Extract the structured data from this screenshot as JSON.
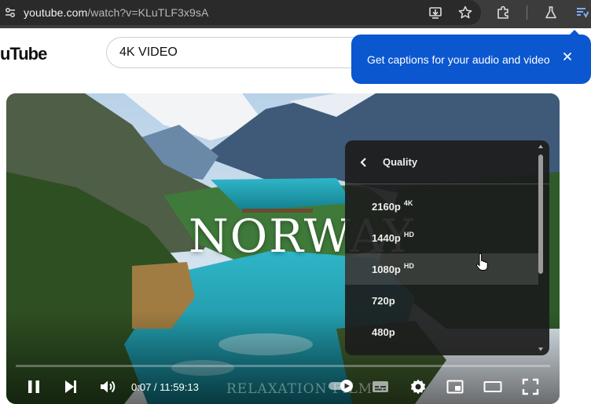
{
  "browser": {
    "url_host": "youtube.com",
    "url_path": "/watch?v=KLuTLF3x9sA",
    "icons": [
      "site-settings-icon",
      "install-app-icon",
      "bookmark-star-icon",
      "extensions-icon",
      "labs-flask-icon",
      "reading-list-icon"
    ]
  },
  "youtube": {
    "logo_text": "uTube",
    "search_value": "4K VIDEO"
  },
  "promo": {
    "text": "Get captions for your audio and video",
    "bg_color": "#0b57d0"
  },
  "video": {
    "title_overlay": "NORWAY",
    "watermark": "RELAXATION FILM",
    "time_current": "0:07",
    "time_separator": " / ",
    "time_total": "11:59:13",
    "progress": 0.0
  },
  "quality_menu": {
    "title": "Quality",
    "items": [
      {
        "label": "2160p",
        "badge": "4K"
      },
      {
        "label": "1440p",
        "badge": "HD"
      },
      {
        "label": "1080p",
        "badge": "HD"
      },
      {
        "label": "720p",
        "badge": ""
      },
      {
        "label": "480p",
        "badge": ""
      }
    ],
    "highlighted_index": 2
  },
  "controls": {
    "icons": [
      "pause-icon",
      "next-icon",
      "volume-icon",
      "autoplay-toggle-icon",
      "subtitles-icon",
      "settings-gear-icon",
      "miniplayer-icon",
      "theater-mode-icon",
      "fullscreen-icon"
    ]
  }
}
